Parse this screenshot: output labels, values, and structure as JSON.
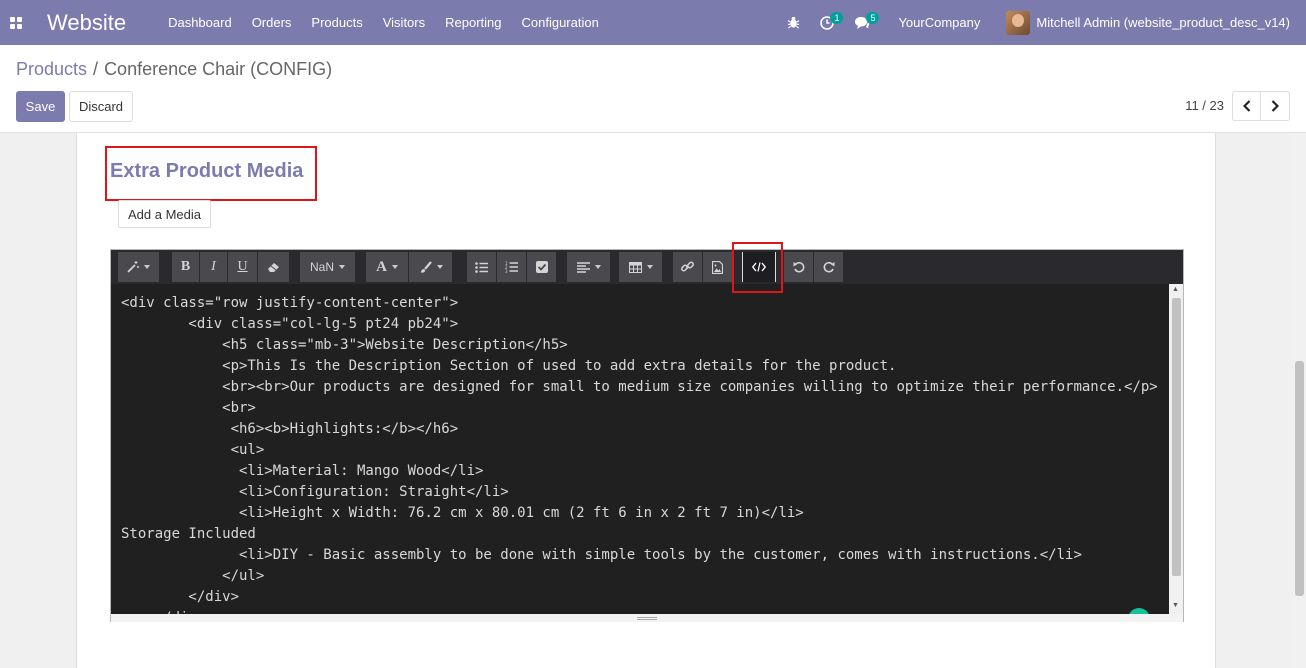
{
  "navbar": {
    "brand": "Website",
    "menu": [
      "Dashboard",
      "Orders",
      "Products",
      "Visitors",
      "Reporting",
      "Configuration"
    ],
    "activity_count": "1",
    "messages_count": "5",
    "company": "YourCompany",
    "user": "Mitchell Admin (website_product_desc_v14)"
  },
  "breadcrumb": {
    "parent": "Products",
    "separator": "/",
    "current": "Conference Chair (CONFIG)"
  },
  "actions": {
    "save": "Save",
    "discard": "Discard"
  },
  "pager": {
    "value": "11 / 23"
  },
  "section": {
    "title": "Extra Product Media",
    "add_media": "Add a Media"
  },
  "toolbar": {
    "font_size": "NaN"
  },
  "code": {
    "content": "<div class=\"row justify-content-center\">\n        <div class=\"col-lg-5 pt24 pb24\">\n            <h5 class=\"mb-3\">Website Description</h5>\n            <p>This Is the Description Section of used to add extra details for the product.\n            <br><br>Our products are designed for small to medium size companies willing to optimize their performance.</p>\n            <br>\n             <h6><b>Highlights:</b></h6>\n             <ul>\n              <li>Material: Mango Wood</li>\n              <li>Configuration: Straight</li>\n              <li>Height x Width: 76.2 cm x 80.01 cm (2 ft 6 in x 2 ft 7 in)</li>\nStorage Included\n              <li>DIY - Basic assembly to be done with simple tools by the customer, comes with instructions.</li>\n            </ul>\n        </div>\n    </div>"
  },
  "colors": {
    "brand": "#7c7bad",
    "highlight": "#e0151a",
    "badge": "#00a09d",
    "editor_bg": "#202020"
  }
}
